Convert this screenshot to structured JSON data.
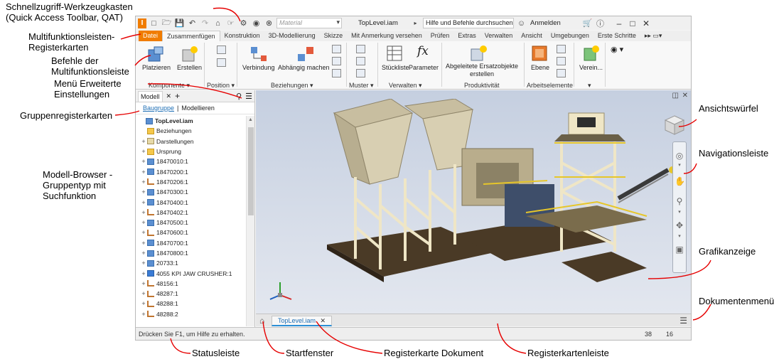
{
  "callouts": {
    "qat": "Schnellzugriff-Werkzeugkasten\n(Quick Access Toolbar, QAT)",
    "ribbon_tabs": "Multifunktionsleisten-\nRegisterkarten",
    "ribbon_commands": "Befehle der\nMultifunktionsleiste",
    "advanced_menu": "Menü Erweiterte\nEinstellungen",
    "group_tabs": "Gruppenregisterkarten",
    "browser": "Modell-Browser -\nGruppentyp mit\nSuchfunktion",
    "viewcube": "Ansichtswürfel",
    "navbar": "Navigationsleiste",
    "graphics": "Grafikanzeige",
    "doc_menu": "Dokumentenmenü",
    "statusbar": "Statusleiste",
    "home": "Startfenster",
    "doc_tab": "Registerkarte Dokument",
    "tabbar": "Registerkartenleiste"
  },
  "titlebar": {
    "material_placeholder": "Material",
    "doc_title": "TopLevel.iam",
    "search": "Hilfe und Befehle durchsuchen...",
    "signin": "Anmelden"
  },
  "tabs": [
    "Datei",
    "Zusammenfügen",
    "Konstruktion",
    "3D-Modellierung",
    "Skizze",
    "Mit Anmerkung versehen",
    "Prüfen",
    "Extras",
    "Verwalten",
    "Ansicht",
    "Umgebungen",
    "Erste Schritte"
  ],
  "ribbon": {
    "place": "Platzieren",
    "create": "Erstellen",
    "group_component": "Komponente",
    "group_position": "Position",
    "joint": "Verbindung",
    "constrain": "Abhängig machen",
    "group_relationships": "Beziehungen",
    "group_pattern": "Muster",
    "bom": "Stückliste",
    "parameters": "Parameter",
    "group_manage": "Verwalten",
    "substitute_line1": "Abgeleitete Ersatzobjekte",
    "substitute_line2": "erstellen",
    "group_productivity": "Produktivität",
    "plane": "Ebene",
    "group_workfeatures": "Arbeitselemente",
    "simplify": "Verein..."
  },
  "browser": {
    "tab_model": "Modell",
    "sub_assembly": "Baugruppe",
    "sub_modeling": "Modellieren",
    "tree": [
      {
        "label": "TopLevel.iam",
        "icon": "asm",
        "expand": "",
        "indent": 0,
        "bold": true
      },
      {
        "label": "Beziehungen",
        "icon": "folder",
        "expand": "",
        "indent": 1
      },
      {
        "label": "Darstellungen",
        "icon": "rep",
        "expand": "+",
        "indent": 1
      },
      {
        "label": "Ursprung",
        "icon": "folder",
        "expand": "+",
        "indent": 1
      },
      {
        "label": "18470010:1",
        "icon": "asm",
        "expand": "+",
        "indent": 1
      },
      {
        "label": "18470200:1",
        "icon": "asm",
        "expand": "+",
        "indent": 1
      },
      {
        "label": "18470206:1",
        "icon": "part",
        "expand": "+",
        "indent": 1
      },
      {
        "label": "18470300:1",
        "icon": "asm",
        "expand": "+",
        "indent": 1
      },
      {
        "label": "18470400:1",
        "icon": "asm",
        "expand": "+",
        "indent": 1
      },
      {
        "label": "18470402:1",
        "icon": "part",
        "expand": "+",
        "indent": 1
      },
      {
        "label": "18470500:1",
        "icon": "asm",
        "expand": "+",
        "indent": 1
      },
      {
        "label": "18470600:1",
        "icon": "part",
        "expand": "+",
        "indent": 1
      },
      {
        "label": "18470700:1",
        "icon": "asm",
        "expand": "+",
        "indent": 1
      },
      {
        "label": "18470800:1",
        "icon": "asm",
        "expand": "+",
        "indent": 1
      },
      {
        "label": "20733:1",
        "icon": "asm",
        "expand": "+",
        "indent": 1
      },
      {
        "label": "4055 KPI JAW CRUSHER:1",
        "icon": "cube",
        "expand": "+",
        "indent": 1
      },
      {
        "label": "48156:1",
        "icon": "part",
        "expand": "+",
        "indent": 1
      },
      {
        "label": "48287:1",
        "icon": "part",
        "expand": "+",
        "indent": 1
      },
      {
        "label": "48288:1",
        "icon": "part",
        "expand": "+",
        "indent": 1
      },
      {
        "label": "48288:2",
        "icon": "part",
        "expand": "+",
        "indent": 1
      }
    ]
  },
  "doc_tab": "TopLevel.iam",
  "status": {
    "help": "Drücken Sie F1, um Hilfe zu erhalten.",
    "count1": "38",
    "count2": "16"
  },
  "colors": {
    "file_tab": "#f07c00",
    "callout_line": "#e60000",
    "accent_blue": "#2c8fd6"
  }
}
